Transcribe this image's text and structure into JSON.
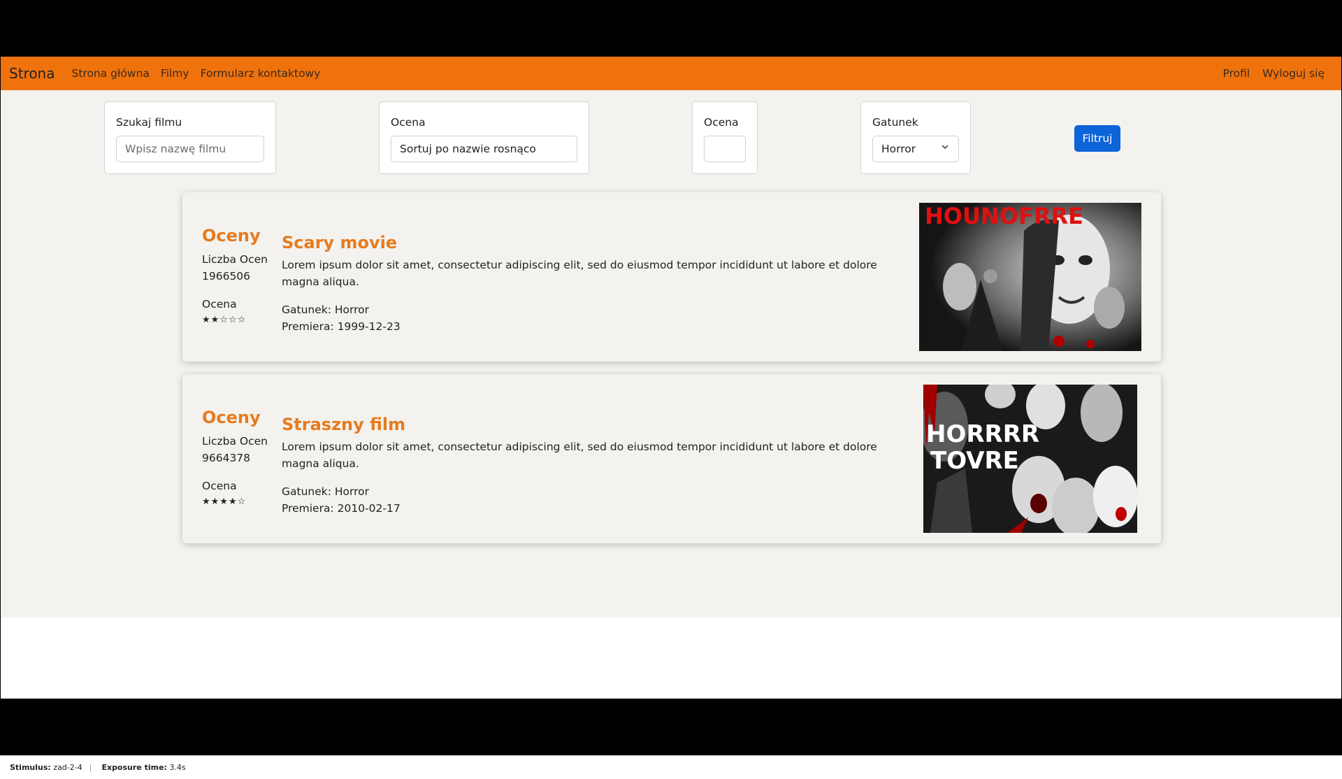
{
  "navbar": {
    "brand": "Strona",
    "links": [
      "Strona główna",
      "Filmy",
      "Formularz kontaktowy"
    ],
    "right_links": [
      "Profil",
      "Wyloguj się"
    ]
  },
  "filters": {
    "search": {
      "label": "Szukaj filmu",
      "placeholder": "Wpisz nazwę filmu"
    },
    "sort": {
      "label": "Ocena",
      "value": "Sortuj po nazwie rosnąco"
    },
    "rating": {
      "label": "Ocena",
      "value": ""
    },
    "genre": {
      "label": "Gatunek",
      "value": "Horror"
    },
    "button": "Filtruj"
  },
  "movies": [
    {
      "ratings_title": "Oceny",
      "count_label": "Liczba Ocen",
      "count": "1966506",
      "rating_label": "Ocena",
      "stars": "★★☆☆☆",
      "title": "Scary movie",
      "description": "Lorem ipsum dolor sit amet, consectetur adipiscing elit, sed do eiusmod tempor incididunt ut labore et dolore magna aliqua.",
      "genre_line": "Gatunek: Horror",
      "premiere_line": "Premiera: 1999-12-23",
      "poster_text": "HOUNOFRRE"
    },
    {
      "ratings_title": "Oceny",
      "count_label": "Liczba Ocen",
      "count": "9664378",
      "rating_label": "Ocena",
      "stars": "★★★★☆",
      "title": "Straszny film",
      "description": "Lorem ipsum dolor sit amet, consectetur adipiscing elit, sed do eiusmod tempor incididunt ut labore et dolore magna aliqua.",
      "genre_line": "Gatunek: Horror",
      "premiere_line": "Premiera: 2010-02-17",
      "poster_text_1": "HORRRR",
      "poster_text_2": "TOVRE"
    }
  ],
  "statusbar": {
    "stimulus_label": "Stimulus:",
    "stimulus_value": "zad-2-4",
    "exposure_label": "Exposure time:",
    "exposure_value": "3.4s"
  },
  "colors": {
    "navbar": "#f0720c",
    "accent": "#e77b1e",
    "button": "#0d63d8",
    "background": "#f3f2ee"
  }
}
